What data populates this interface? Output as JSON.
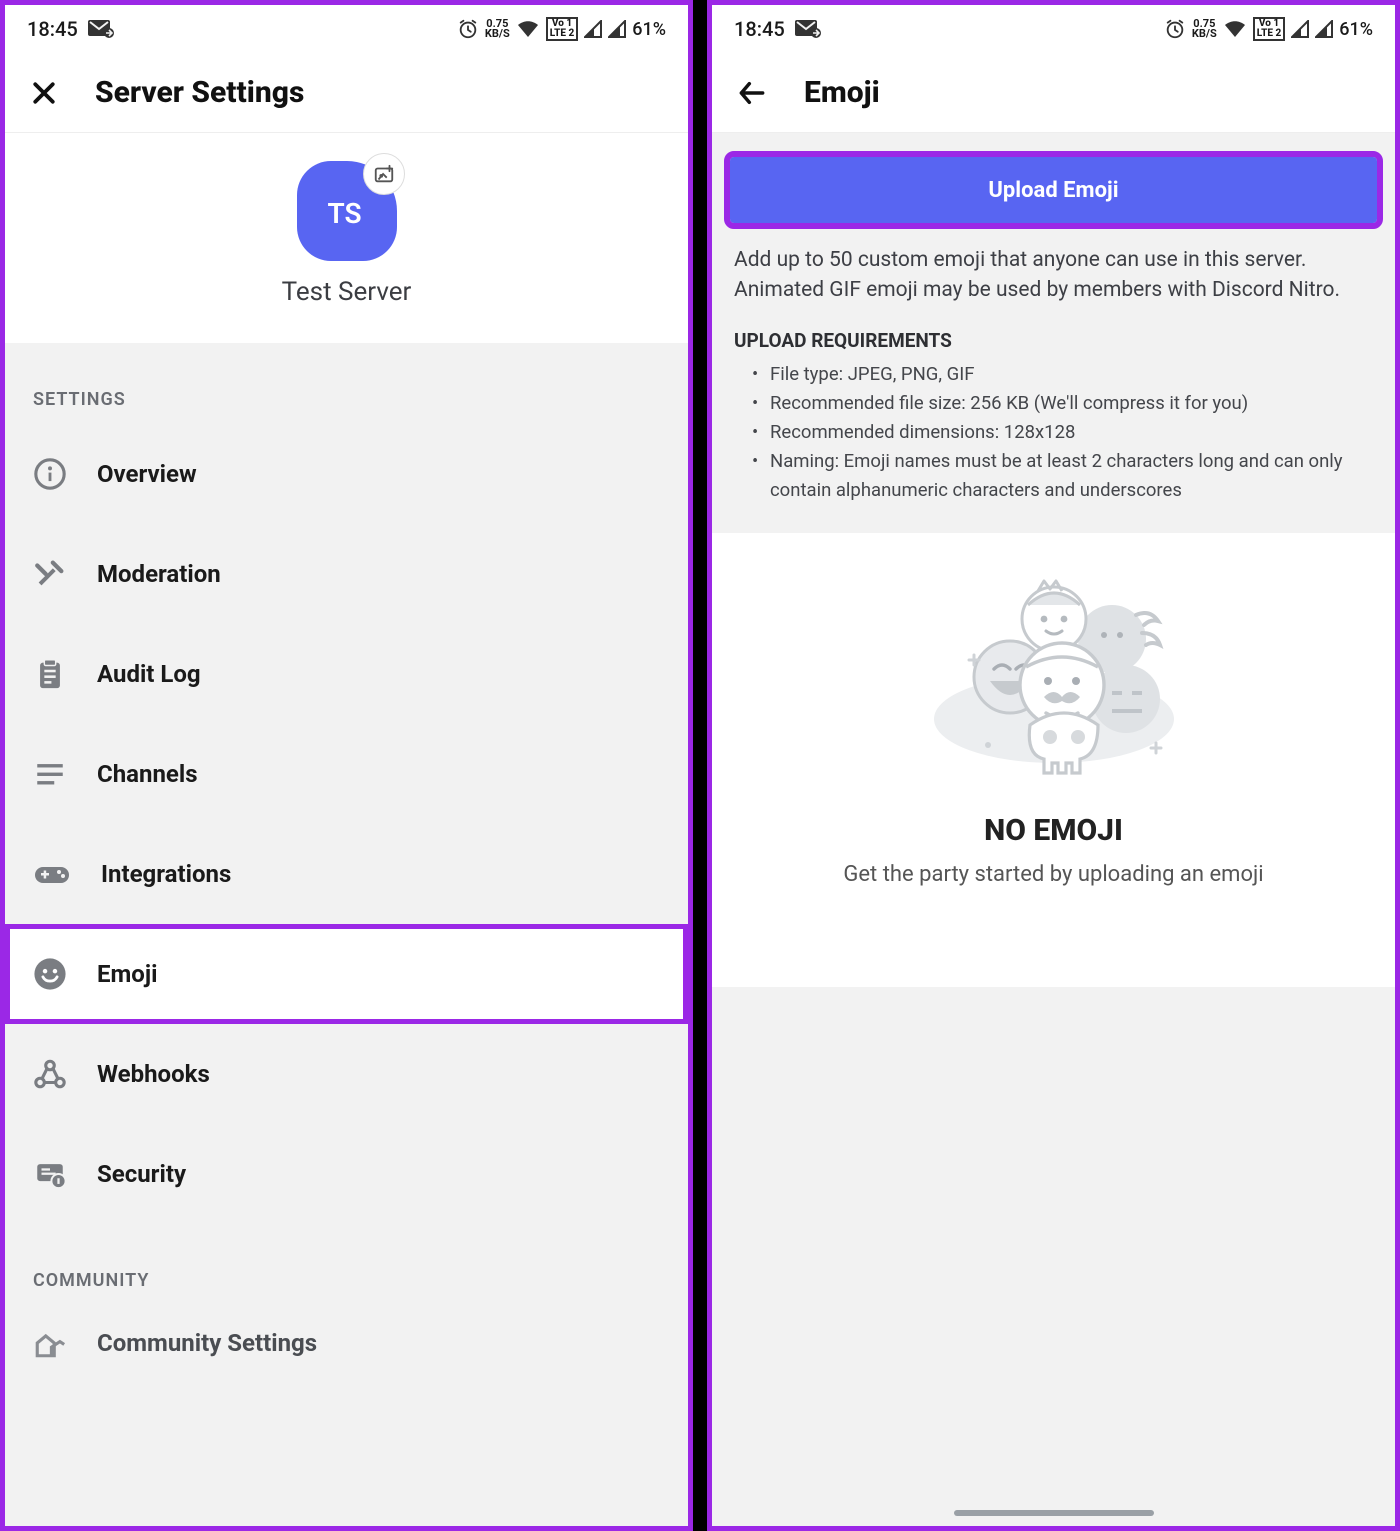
{
  "status": {
    "time": "18:45",
    "kbps_top": "0.75",
    "kbps_bottom": "KB/S",
    "lte_top": "Vo 1",
    "lte_bottom": "LTE 2",
    "battery": "61%"
  },
  "left": {
    "title": "Server Settings",
    "server_initials": "TS",
    "server_name": "Test Server",
    "section_settings": "SETTINGS",
    "section_community": "COMMUNITY",
    "items": {
      "overview": "Overview",
      "moderation": "Moderation",
      "audit": "Audit Log",
      "channels": "Channels",
      "integrations": "Integrations",
      "emoji": "Emoji",
      "webhooks": "Webhooks",
      "security": "Security",
      "community": "Community Settings"
    }
  },
  "right": {
    "title": "Emoji",
    "upload_label": "Upload Emoji",
    "description": "Add up to 50 custom emoji that anyone can use in this server. Animated GIF emoji may be used by members with Discord Nitro.",
    "req_title": "UPLOAD REQUIREMENTS",
    "reqs": [
      "File type: JPEG, PNG, GIF",
      "Recommended file size: 256 KB (We'll compress it for you)",
      "Recommended dimensions: 128x128",
      "Naming: Emoji names must be at least 2 characters long and can only contain alphanumeric characters and underscores"
    ],
    "empty_title": "NO EMOJI",
    "empty_sub": "Get the party started by uploading an emoji"
  }
}
